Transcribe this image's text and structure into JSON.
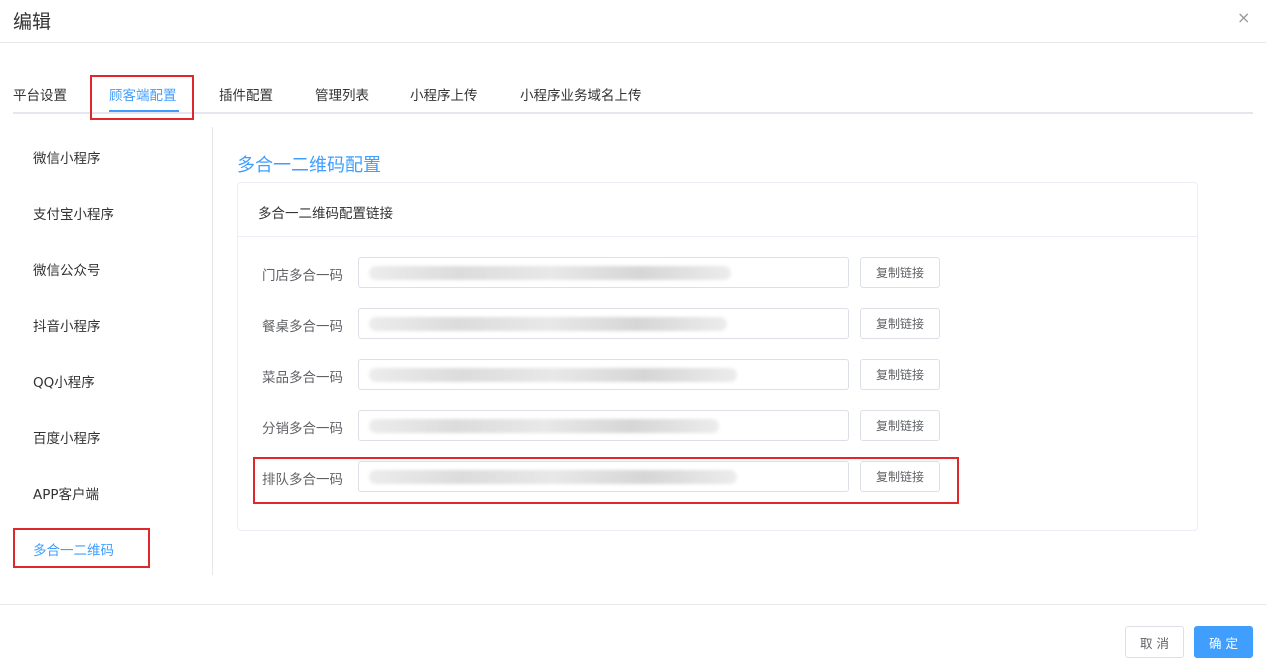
{
  "dialog": {
    "title": "编辑",
    "close_icon": "×"
  },
  "tabs": [
    {
      "label": "平台设置"
    },
    {
      "label": "顾客端配置",
      "active": true
    },
    {
      "label": "插件配置"
    },
    {
      "label": "管理列表"
    },
    {
      "label": "小程序上传"
    },
    {
      "label": "小程序业务域名上传"
    }
  ],
  "sidebar": {
    "items": [
      {
        "label": "微信小程序"
      },
      {
        "label": "支付宝小程序"
      },
      {
        "label": "微信公众号"
      },
      {
        "label": "抖音小程序"
      },
      {
        "label": "QQ小程序"
      },
      {
        "label": "百度小程序"
      },
      {
        "label": "APP客户端"
      },
      {
        "label": "多合一二维码",
        "active": true
      }
    ]
  },
  "main": {
    "section_title": "多合一二维码配置",
    "panel_title": "多合一二维码配置链接",
    "rows": [
      {
        "label": "门店多合一码",
        "value": "",
        "button": "复制链接"
      },
      {
        "label": "餐桌多合一码",
        "value": "",
        "button": "复制链接"
      },
      {
        "label": "菜品多合一码",
        "value": "",
        "button": "复制链接"
      },
      {
        "label": "分销多合一码",
        "value": "",
        "button": "复制链接"
      },
      {
        "label": "排队多合一码",
        "value": "",
        "button": "复制链接"
      }
    ]
  },
  "footer": {
    "cancel": "取 消",
    "confirm": "确 定"
  },
  "colors": {
    "accent": "#409eff",
    "highlight": "#e0282c"
  }
}
